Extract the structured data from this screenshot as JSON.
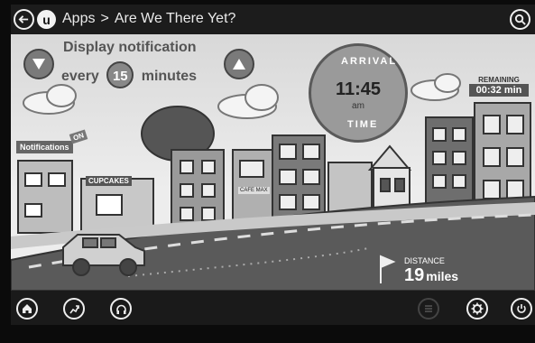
{
  "topbar": {
    "breadcrumb_root": "Apps",
    "breadcrumb_separator": ">",
    "breadcrumb_current": "Are We There Yet?",
    "logo_letter": "u"
  },
  "notification": {
    "line1": "Display notification",
    "line2_prefix": "every",
    "minutes_value": "15",
    "line2_suffix": "minutes"
  },
  "arrival": {
    "top_word": "ARRIVAL",
    "bottom_word": "TIME",
    "time": "11:45",
    "ampm": "am"
  },
  "remaining": {
    "label": "REMAINING",
    "value": "00:32 min"
  },
  "signs": {
    "notifications": "Notifications",
    "on": "ON",
    "cupcakes": "CUPCAKES",
    "cafe": "CAFE MAX"
  },
  "distance": {
    "label": "DISTANCE",
    "value": "19",
    "unit": "miles"
  },
  "colors": {
    "topbar_bg": "#1c1c1c",
    "bottombar_bg": "#1a1a1a",
    "scene_sky": "#d8d8d8",
    "road": "#5a5a5a"
  },
  "icons": {
    "back": "back-arrow-icon",
    "search": "search-icon",
    "home": "home-icon",
    "nav": "navigation-icon",
    "media": "headphones-icon",
    "menu": "menu-icon",
    "settings": "gear-icon",
    "power": "power-icon"
  }
}
